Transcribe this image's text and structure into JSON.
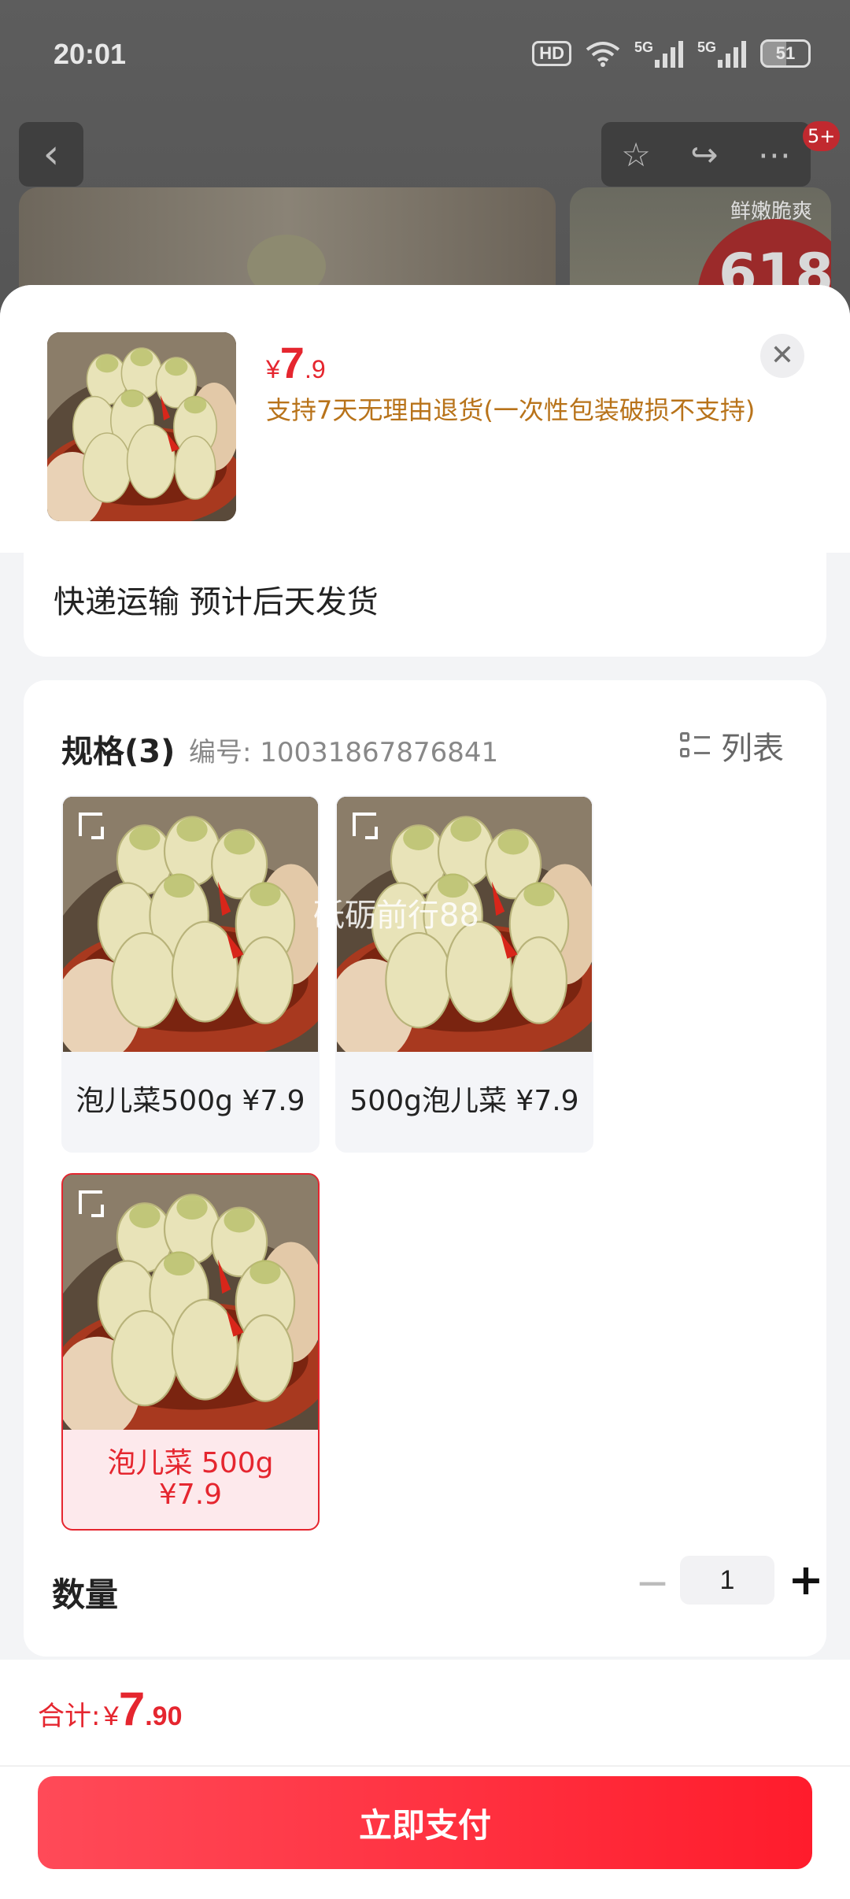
{
  "status_bar": {
    "time": "20:01",
    "hd": "HD",
    "net1": "5G",
    "net2": "5G",
    "battery": "51"
  },
  "nav": {
    "badge": "5+"
  },
  "background": {
    "promo_text": "鲜嫩脆爽",
    "promo_badge": "618"
  },
  "product": {
    "price_currency": "¥",
    "price_int": "7",
    "price_dec": ".9",
    "return_policy": "支持7天无理由退货(一次性包装破损不支持)"
  },
  "shipping": {
    "text": "快递运输 预计后天发货"
  },
  "spec": {
    "title": "规格(3)",
    "code": "编号: 10031867876841",
    "view_toggle": "列表",
    "options": [
      {
        "label": "泡儿菜500g ¥7.9",
        "selected": false
      },
      {
        "label": "500g泡儿菜 ¥7.9",
        "selected": false
      },
      {
        "label_line1": "泡儿菜 500g",
        "label_line2": "¥7.9",
        "selected": true
      }
    ],
    "watermark": "砥砺前行88"
  },
  "quantity": {
    "label": "数量",
    "value": "1",
    "minus": "−",
    "plus": "+"
  },
  "footer": {
    "total_label": "合计:",
    "total_currency": "¥",
    "total_int": "7",
    "total_dec": ".90",
    "pay_button": "立即支付"
  },
  "colors": {
    "accent": "#e5262f",
    "policy": "#b8731a"
  }
}
